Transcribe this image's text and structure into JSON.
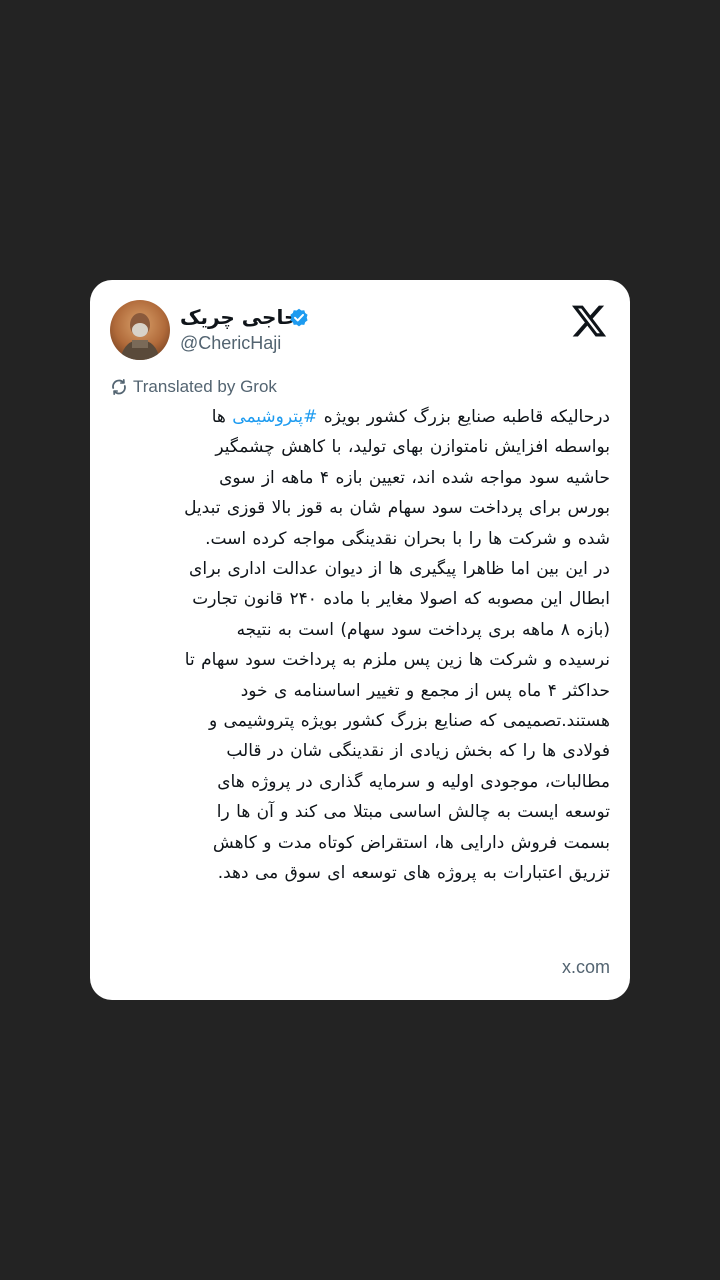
{
  "author": {
    "display_name": "حاجی چریک",
    "handle": "@ChericHaji",
    "verified": true,
    "avatar_icon": "profile-photo"
  },
  "platform": {
    "logo_icon": "x-logo",
    "footer_domain": "x.com"
  },
  "translation": {
    "label": "Translated by Grok",
    "icon": "translate-icon"
  },
  "tweet": {
    "hashtag": "#پتروشیمی",
    "line_1_before_hashtag": "درحالیکه قاطبه صنایع بزرگ کشور بویژه ",
    "line_1_after_hashtag": " ها",
    "lines": [
      "بواسطه افزایش نامتوازن بهای تولید، با کاهش چشمگیر",
      "حاشیه سود  مواجه شده اند، تعیین بازه ۴ ماهه از سوی",
      "بورس برای پرداخت سود سهام شان به قوز بالا قوزی تبدیل",
      "شده و شرکت ها را با بحران نقدینگی مواجه کرده است.",
      "در این بین اما ظاهرا پیگیری ها از دیوان عدالت اداری برای",
      "ابطال این مصوبه که اصولا مغایر با ماده ۲۴۰ قانون تجارت",
      "(بازه ۸ ماهه بری پرداخت سود سهام) است به نتیجه",
      "نرسیده و شرکت ها زین پس ملزم به پرداخت سود سهام تا",
      "حداکثر ۴ ماه پس از مجمع و تغییر اساسنامه ی خود",
      "هستند.تصمیمی که صنایع بزرگ کشور بویژه پتروشیمی و",
      "فولادی ها را که بخش زیادی از نقدینگی شان در قالب",
      "مطالبات، موجودی اولیه و سرمایه گذاری در پروژه های",
      "توسعه ایست به چالش اساسی مبتلا می کند و آن ها را",
      "بسمت فروش دارایی ها، استقراض کوتاه مدت و کاهش",
      "تزریق اعتبارات به پروژه های توسعه ای سوق می دهد."
    ]
  },
  "colors": {
    "background": "#232323",
    "card": "#ffffff",
    "text": "#0f1419",
    "muted": "#536471",
    "accent": "#1d9bf0"
  }
}
